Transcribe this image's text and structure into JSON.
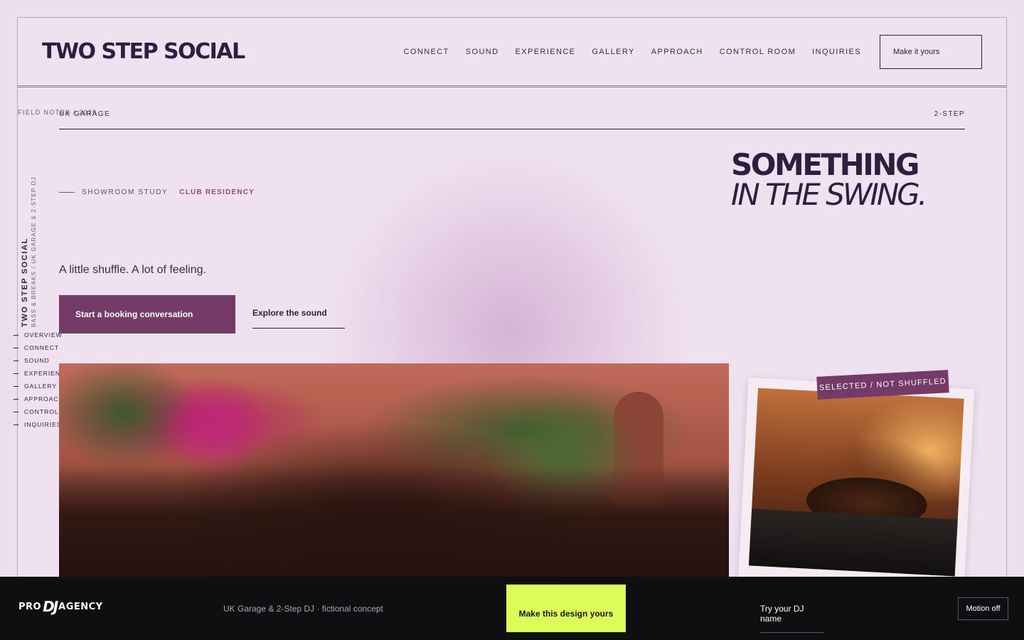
{
  "header": {
    "brand": "TWO STEP SOCIAL",
    "nav": [
      "CONNECT",
      "SOUND",
      "EXPERIENCE",
      "GALLERY",
      "APPROACH",
      "CONTROL ROOM",
      "INQUIRIES"
    ],
    "cta": "Make it yours"
  },
  "topline": {
    "field_notes": "FIELD NOTES / 2025",
    "left_tag": "UK GARAGE",
    "right_tag": "2-STEP"
  },
  "side": {
    "title": "TWO STEP SOCIAL",
    "subtitle": "BASS & BREAKS / UK GARAGE & 2-STEP DJ",
    "nav": [
      "OVERVIEW",
      "CONNECT",
      "SOUND",
      "EXPERIENCE",
      "GALLERY",
      "APPROACH",
      "CONTROL ROOM",
      "INQUIRIES"
    ]
  },
  "hero": {
    "eyebrow_1": "SHOWROOM STUDY",
    "eyebrow_2": "CLUB RESIDENCY",
    "headline_1": "SOMETHING",
    "headline_2": "IN THE SWING.",
    "lede": "A little shuffle. A lot of feeling.",
    "primary_button": "Start a booking conversation",
    "secondary_link": "Explore the sound",
    "stamp": "SELECTED / NOT SHUFFLED"
  },
  "footer": {
    "logo_pre": "PRO",
    "logo_mid": "DJ",
    "logo_post": "AGENCY",
    "concept": "UK Garage & 2-Step DJ · fictional concept",
    "make_button": "Make this design yours",
    "try_link": "Try your DJ name",
    "motion_button": "Motion off"
  },
  "colors": {
    "background": "#ecdeec",
    "ink": "#2e1f3e",
    "plum": "#743a68",
    "accent_lime": "#dcfc5a",
    "footer_bg": "#0f0f12"
  }
}
